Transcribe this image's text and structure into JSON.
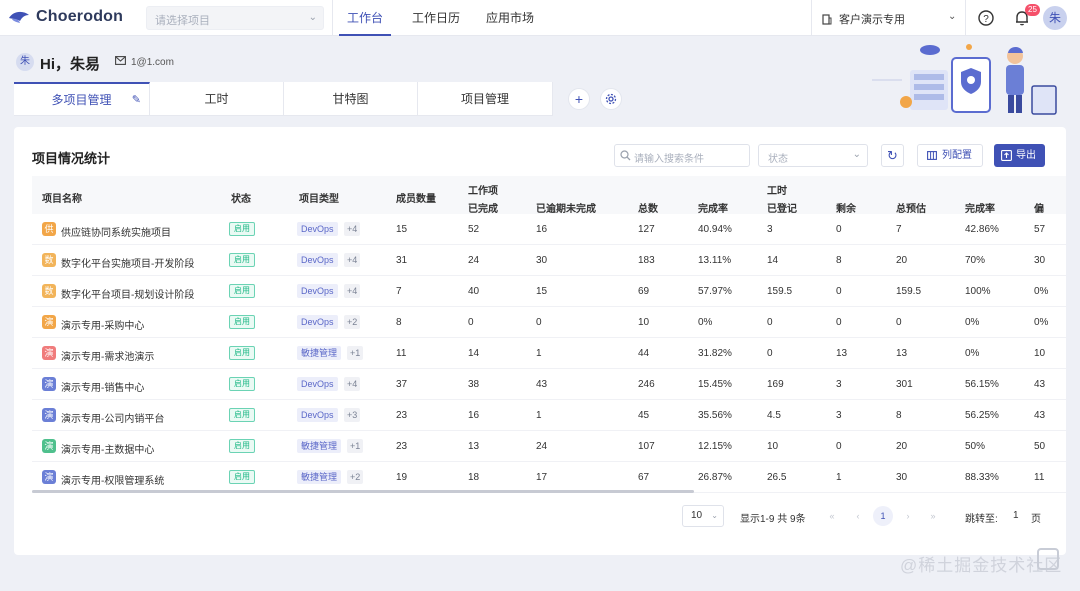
{
  "app": {
    "name": "Choerodon",
    "project_placeholder": "请选择项目",
    "nav": [
      "工作台",
      "工作日历",
      "应用市场"
    ],
    "org": "客户演示专用",
    "notification_count": "25",
    "user_avatar": "朱"
  },
  "header": {
    "avatar": "朱",
    "greeting": "Hi，朱易",
    "email": "1@1.com"
  },
  "tabs": [
    {
      "label": "多项目管理",
      "active": true
    },
    {
      "label": "工时",
      "active": false
    },
    {
      "label": "甘特图",
      "active": false
    },
    {
      "label": "项目管理",
      "active": false
    }
  ],
  "card": {
    "title": "项目情况统计",
    "search_placeholder": "请输入搜索条件",
    "status_placeholder": "状态",
    "colcfg_label": "列配置",
    "export_label": "导出"
  },
  "table": {
    "group_headers": [
      "工作项",
      "工时"
    ],
    "headers": [
      "项目名称",
      "状态",
      "项目类型",
      "成员数量",
      "已完成",
      "已逾期未完成",
      "总数",
      "完成率",
      "已登记",
      "剩余",
      "总预估",
      "完成率",
      "偏"
    ],
    "rows": [
      {
        "icon": "供",
        "icon_color": "#f2a648",
        "name": "供应链协同系统实施项目",
        "status": "启用",
        "type": "DevOps",
        "more": "+4",
        "members": "15",
        "done": "52",
        "overdue": "16",
        "total": "127",
        "rate": "40.94%",
        "logged": "3",
        "remain": "0",
        "estimate": "7",
        "hrate": "42.86%",
        "dev": "57"
      },
      {
        "icon": "数",
        "icon_color": "#f2b45a",
        "name": "数字化平台实施项目-开发阶段",
        "status": "启用",
        "type": "DevOps",
        "more": "+4",
        "members": "31",
        "done": "24",
        "overdue": "30",
        "total": "183",
        "rate": "13.11%",
        "logged": "14",
        "remain": "8",
        "estimate": "20",
        "hrate": "70%",
        "dev": "30"
      },
      {
        "icon": "数",
        "icon_color": "#f2b45a",
        "name": "数字化平台项目-规划设计阶段",
        "status": "启用",
        "type": "DevOps",
        "more": "+4",
        "members": "7",
        "done": "40",
        "overdue": "15",
        "total": "69",
        "rate": "57.97%",
        "logged": "159.5",
        "remain": "0",
        "estimate": "159.5",
        "hrate": "100%",
        "dev": "0%"
      },
      {
        "icon": "演",
        "icon_color": "#f2a648",
        "name": "演示专用-采购中心",
        "status": "启用",
        "type": "DevOps",
        "more": "+2",
        "members": "8",
        "done": "0",
        "overdue": "0",
        "total": "10",
        "rate": "0%",
        "logged": "0",
        "remain": "0",
        "estimate": "0",
        "hrate": "0%",
        "dev": "0%"
      },
      {
        "icon": "演",
        "icon_color": "#f07c7c",
        "name": "演示专用-需求池演示",
        "status": "启用",
        "type": "敏捷管理",
        "more": "+1",
        "members": "11",
        "done": "14",
        "overdue": "1",
        "total": "44",
        "rate": "31.82%",
        "logged": "0",
        "remain": "13",
        "estimate": "13",
        "hrate": "0%",
        "dev": "10"
      },
      {
        "icon": "演",
        "icon_color": "#6b7fd6",
        "name": "演示专用-销售中心",
        "status": "启用",
        "type": "DevOps",
        "more": "+4",
        "members": "37",
        "done": "38",
        "overdue": "43",
        "total": "246",
        "rate": "15.45%",
        "logged": "169",
        "remain": "3",
        "estimate": "301",
        "hrate": "56.15%",
        "dev": "43"
      },
      {
        "icon": "演",
        "icon_color": "#6b7fd6",
        "name": "演示专用-公司内销平台",
        "status": "启用",
        "type": "DevOps",
        "more": "+3",
        "members": "23",
        "done": "16",
        "overdue": "1",
        "total": "45",
        "rate": "35.56%",
        "logged": "4.5",
        "remain": "3",
        "estimate": "8",
        "hrate": "56.25%",
        "dev": "43"
      },
      {
        "icon": "演",
        "icon_color": "#4fc08d",
        "name": "演示专用-主数据中心",
        "status": "启用",
        "type": "敏捷管理",
        "more": "+1",
        "members": "23",
        "done": "13",
        "overdue": "24",
        "total": "107",
        "rate": "12.15%",
        "logged": "10",
        "remain": "0",
        "estimate": "20",
        "hrate": "50%",
        "dev": "50"
      },
      {
        "icon": "演",
        "icon_color": "#6b7fd6",
        "name": "演示专用-权限管理系统",
        "status": "启用",
        "type": "敏捷管理",
        "more": "+2",
        "members": "19",
        "done": "18",
        "overdue": "17",
        "total": "67",
        "rate": "26.87%",
        "logged": "26.5",
        "remain": "1",
        "estimate": "30",
        "hrate": "88.33%",
        "dev": "11"
      }
    ]
  },
  "pagination": {
    "page_size": "10",
    "info": "显示1-9 共 9条",
    "current": "1",
    "jump_label": "跳转至:",
    "jump_value": "1",
    "jump_unit": "页"
  },
  "watermark": "@稀土掘金技术社区"
}
